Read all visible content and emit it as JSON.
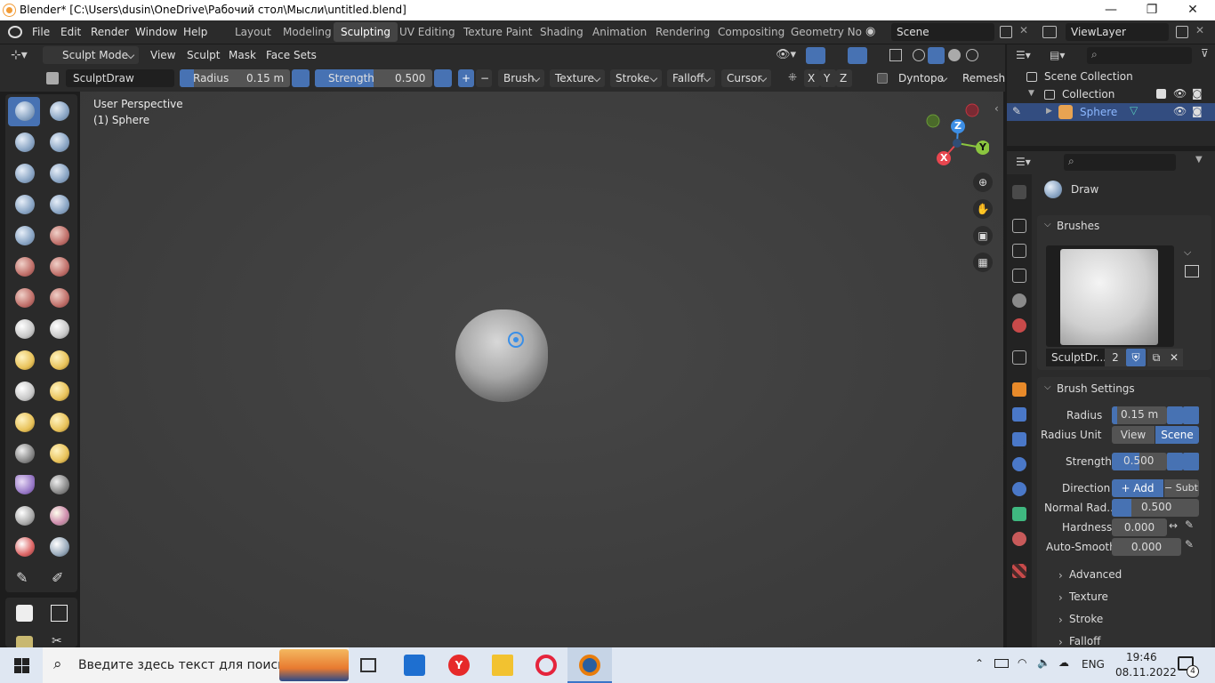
{
  "window": {
    "title": "Blender* [C:\\Users\\dusin\\OneDrive\\Рабочий стол\\Мысли\\untitled.blend]",
    "min": "—",
    "max": "❐",
    "close": "✕"
  },
  "menus": [
    "File",
    "Edit",
    "Render",
    "Window",
    "Help"
  ],
  "workspaces": [
    "Layout",
    "Modeling",
    "Sculpting",
    "UV Editing",
    "Texture Paint",
    "Shading",
    "Animation",
    "Rendering",
    "Compositing",
    "Geometry Noc"
  ],
  "active_workspace": "Sculpting",
  "scene": "Scene",
  "view_layer": "ViewLayer",
  "header1": {
    "mode": "Sculpt Mode",
    "view": "View",
    "sculpt": "Sculpt",
    "mask": "Mask",
    "face_sets": "Face Sets"
  },
  "header2": {
    "brush_name": "SculptDraw",
    "radius_label": "Radius",
    "radius_value": "0.15 m",
    "strength_label": "Strength",
    "strength_value": "0.500",
    "plus": "+",
    "minus": "−",
    "brush": "Brush",
    "texture": "Texture",
    "stroke": "Stroke",
    "falloff": "Falloff",
    "cursor": "Cursor",
    "x": "X",
    "y": "Y",
    "z": "Z",
    "dyntopo": "Dyntopo",
    "remesh": "Remesh"
  },
  "viewport": {
    "perspective": "User Perspective",
    "object": "(1) Sphere"
  },
  "gizmo": {
    "x": "X",
    "y": "Y",
    "z": "Z"
  },
  "outliner": {
    "scene_collection": "Scene Collection",
    "collection": "Collection",
    "sphere": "Sphere"
  },
  "properties": {
    "tool": "Draw",
    "brushes": "Brushes",
    "brush_name": "SculptDr...",
    "users": "2",
    "brush_settings": "Brush Settings",
    "radius_label": "Radius",
    "radius_value": "0.15 m",
    "radius_unit_label": "Radius Unit",
    "unit_view": "View",
    "unit_scene": "Scene",
    "strength_label": "Strength",
    "strength_value": "0.500",
    "direction_label": "Direction",
    "dir_add": "+ Add",
    "dir_sub": "− Subt...",
    "normal_radius_label": "Normal Rad...",
    "normal_radius_value": "0.500",
    "hardness_label": "Hardness",
    "hardness_value": "0.000",
    "autosmooth_label": "Auto-Smooth",
    "autosmooth_value": "0.000",
    "advanced": "Advanced",
    "texture": "Texture",
    "stroke": "Stroke",
    "falloff": "Falloff"
  },
  "taskbar": {
    "search_placeholder": "Введите здесь текст для поиска",
    "lang": "ENG",
    "time": "19:46",
    "date": "08.11.2022",
    "notifications": "4"
  },
  "colors": {
    "accent": "#4772b3",
    "x_axis": "#e8464f",
    "y_axis": "#8bc53f",
    "z_axis": "#3d8fe6"
  }
}
